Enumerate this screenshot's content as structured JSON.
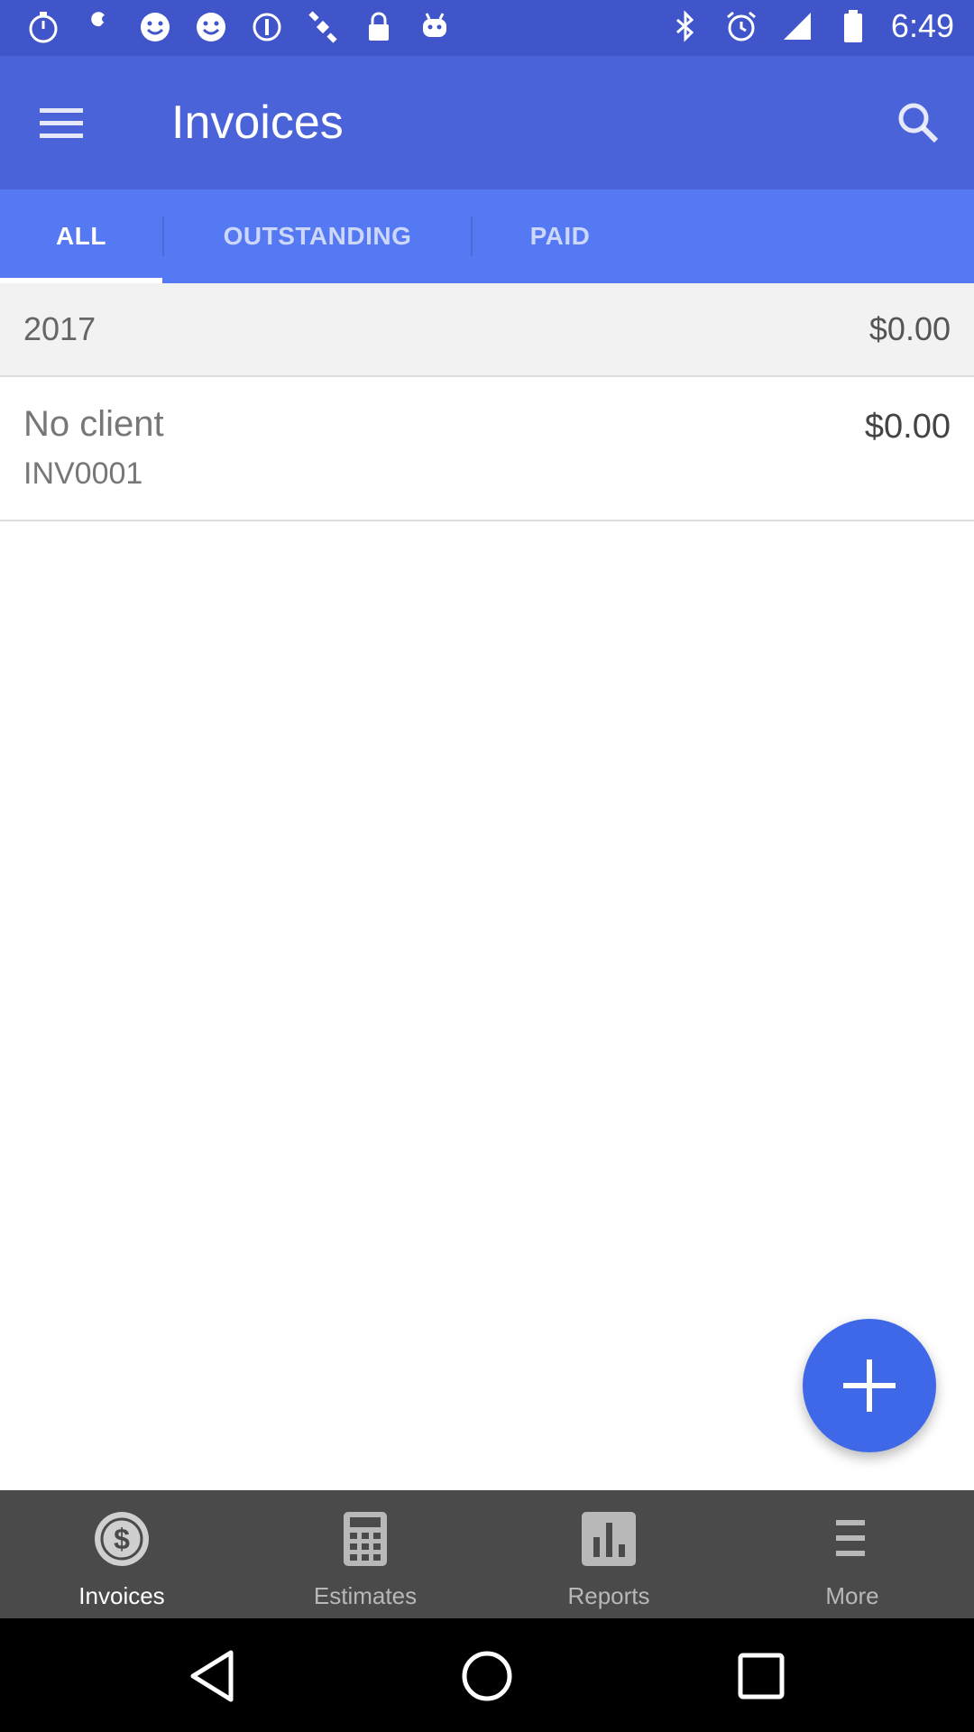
{
  "status_bar": {
    "time": "6:49",
    "left_icons": [
      "stopwatch-icon",
      "wrench-icon",
      "smiley-icon",
      "smiley-icon",
      "disc-icon",
      "satellite-icon",
      "lock-icon",
      "android-icon"
    ],
    "right_icons": [
      "bluetooth-icon",
      "alarm-icon",
      "signal-icon",
      "battery-icon"
    ]
  },
  "toolbar": {
    "title": "Invoices",
    "menu_icon": "menu-icon",
    "search_icon": "search-icon"
  },
  "tabs": [
    {
      "label": "ALL",
      "active": true
    },
    {
      "label": "OUTSTANDING",
      "active": false
    },
    {
      "label": "PAID",
      "active": false
    }
  ],
  "list": {
    "group": {
      "year": "2017",
      "total": "$0.00"
    },
    "invoices": [
      {
        "client": "No client",
        "number": "INV0001",
        "amount": "$0.00"
      }
    ]
  },
  "fab": {
    "icon": "plus-icon"
  },
  "bottom_nav": [
    {
      "label": "Invoices",
      "icon": "dollar-icon",
      "active": true
    },
    {
      "label": "Estimates",
      "icon": "calculator-icon",
      "active": false
    },
    {
      "label": "Reports",
      "icon": "bar-chart-icon",
      "active": false
    },
    {
      "label": "More",
      "icon": "more-menu-icon",
      "active": false
    }
  ],
  "colors": {
    "toolbar": "#4a63d8",
    "tabs": "#5479f2",
    "fab": "#3f68e8",
    "bottom_nav": "#4a4a4a"
  }
}
